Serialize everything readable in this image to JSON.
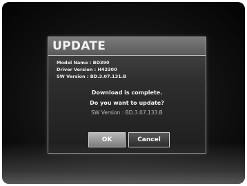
{
  "dialog": {
    "title": "UPDATE",
    "info": [
      "Model Name : BD390",
      "Driver Version : H42300",
      "SW Version : BD.3.07.131.B"
    ],
    "message_line1": "Download is complete.",
    "message_line2": "Do you want to update?",
    "new_sw_version": "SW Version : BD.3.07.133.B",
    "ok_label": "OK",
    "cancel_label": "Cancel"
  }
}
